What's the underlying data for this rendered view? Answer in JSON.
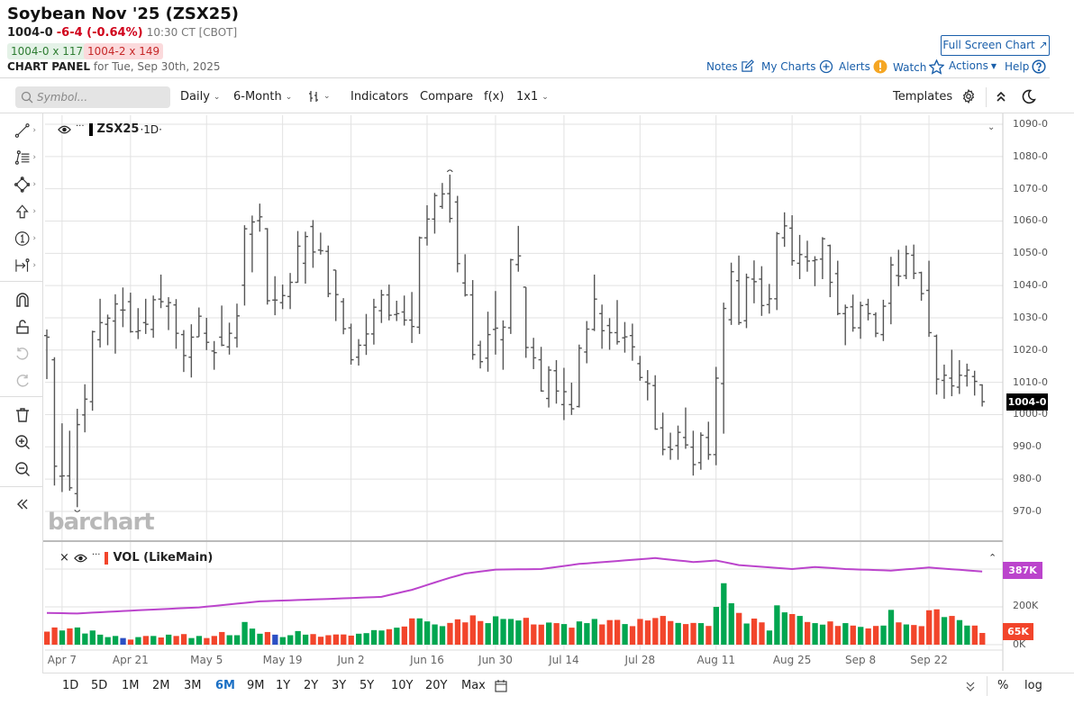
{
  "header": {
    "title": "Soybean Nov '25 (ZSX25)",
    "last": "1004-0",
    "change": "-6-4 (-0.64%)",
    "time": "10:30 CT [CBOT]",
    "bid": "1004-0 x 117",
    "ask": "1004-2 x 149",
    "panel_label": "CHART PANEL",
    "panel_date": "for Tue, Sep 30th, 2025",
    "full_screen": "Full Screen Chart",
    "links": {
      "notes": "Notes",
      "my_charts": "My Charts",
      "alerts": "Alerts",
      "watch": "Watch",
      "actions": "Actions",
      "help": "Help"
    }
  },
  "toolbar": {
    "symbol_placeholder": "Symbol...",
    "interval": "Daily",
    "range": "6-Month",
    "indicators": "Indicators",
    "compare": "Compare",
    "fx": "f(x)",
    "layout": "1x1",
    "templates": "Templates"
  },
  "left_tools": [
    "trend-line",
    "fibonacci",
    "shapes",
    "arrow",
    "annotation-number",
    "measure",
    "magnet",
    "lock",
    "undo",
    "redo",
    "delete",
    "zoom-in",
    "zoom-out",
    "collapse"
  ],
  "legend": {
    "symbol": "ZSX25",
    "interval": "·1D·",
    "volume": "VOL (LikeMain)"
  },
  "watermark": "barchart",
  "colors": {
    "up": "#00a650",
    "down": "#f2452b",
    "unch": "#2b4fc4",
    "ma": "#bb44cc",
    "bar": "#555555",
    "accent": "#1a5faa"
  },
  "chart_data": {
    "type": "ohlc",
    "title": "ZSX25 ·1D·",
    "ylim": [
      965,
      1093
    ],
    "yticks": [
      "1090-0",
      "1080-0",
      "1070-0",
      "1060-0",
      "1050-0",
      "1040-0",
      "1030-0",
      "1020-0",
      "1010-0",
      "1000-0",
      "990-0",
      "980-0",
      "970-0"
    ],
    "ytick_values": [
      1090,
      1080,
      1070,
      1060,
      1050,
      1040,
      1030,
      1020,
      1010,
      1000,
      990,
      980,
      970
    ],
    "last_price_label": "1004-0",
    "last_price": 1004,
    "x_labels": [
      {
        "label": "Apr 7",
        "bar": 2
      },
      {
        "label": "Apr 21",
        "bar": 11
      },
      {
        "label": "May 5",
        "bar": 21
      },
      {
        "label": "May 19",
        "bar": 31
      },
      {
        "label": "Jun 2",
        "bar": 40
      },
      {
        "label": "Jun 16",
        "bar": 50
      },
      {
        "label": "Jun 30",
        "bar": 59
      },
      {
        "label": "Jul 14",
        "bar": 68
      },
      {
        "label": "Jul 28",
        "bar": 78
      },
      {
        "label": "Aug 11",
        "bar": 88
      },
      {
        "label": "Aug 25",
        "bar": 98
      },
      {
        "label": "Sep 8",
        "bar": 107
      },
      {
        "label": "Sep 22",
        "bar": 116
      }
    ],
    "open": [
      1024.5,
      1017,
      980.9,
      981,
      975.5,
      999.9,
      1004,
      1023.2,
      1028,
      1029,
      1032.4,
      1035,
      1025.7,
      1028.5,
      1026.4,
      1035.8,
      1033.6,
      1034,
      1024.8,
      1017.8,
      1024.1,
      1025.2,
      1019.7,
      1024,
      1021,
      1023.8,
      1040.1,
      1055.9,
      1060.1,
      1057.6,
      1035.5,
      1034.7,
      1036.6,
      1041,
      1046.9,
      1058.3,
      1051,
      1050.6,
      1044.8,
      1035,
      1026.9,
      1017.8,
      1021.5,
      1025,
      1032.2,
      1037.1,
      1031,
      1031.8,
      1029.3,
      1027.1,
      1054.8,
      1060.6,
      1064.5,
      1068.5,
      1065.9,
      1040.8,
      1037.1,
      1021.5,
      1017.5,
      1026.4,
      1023.2,
      1026.9,
      1046.5,
      1039.5,
      1020.8,
      1017,
      1005,
      1013.6,
      1003.1,
      1003.1,
      1002.5,
      1019.4,
      1026.4,
      1031.3,
      1027.6,
      1025.4,
      1023.8,
      1024.5,
      1015.8,
      1010.1,
      1009,
      995.9,
      989.9,
      990.4,
      992.9,
      989.9,
      985.1,
      992.9,
      987.6,
      1009.6,
      1029.4,
      1041.5,
      1029.1,
      1042,
      1042,
      1034.1,
      1035.9,
      1054.8,
      1057.8,
      1046.9,
      1048.9,
      1047.7,
      1048.2,
      1052.4,
      1043.7,
      1031.3,
      1033.4,
      1026.9,
      1034.1,
      1031,
      1024.8,
      1034.5,
      1043.1,
      1043.1,
      1049.4,
      1044,
      1038.5,
      1024.3,
      1010.6,
      1011.3,
      1008.5,
      1012,
      1011.8,
      1009.2
    ],
    "high": [
      1026.4,
      1017.8,
      997.3,
      995,
      1001.8,
      1009.4,
      1026,
      1035.9,
      1031,
      1037.3,
      1039.4,
      1037.8,
      1033,
      1035.9,
      1036.9,
      1043.4,
      1036.4,
      1035.8,
      1026.2,
      1028,
      1033.2,
      1030,
      1022.8,
      1033.8,
      1028.5,
      1034.4,
      1058.7,
      1061.7,
      1065.4,
      1057.8,
      1042.9,
      1040.3,
      1043.9,
      1056.9,
      1056.7,
      1060.3,
      1056.4,
      1052.4,
      1044.8,
      1036.1,
      1028.2,
      1023.4,
      1031.2,
      1035.9,
      1038.7,
      1040.3,
      1035.3,
      1036.9,
      1038,
      1055.2,
      1064.9,
      1068.7,
      1071.8,
      1074.4,
      1067.8,
      1049.7,
      1041.7,
      1022.9,
      1031.9,
      1038.3,
      1029.2,
      1048.3,
      1058.5,
      1039.5,
      1023.8,
      1021,
      1015,
      1016.9,
      1014.5,
      1009.9,
      1021.7,
      1029,
      1043.4,
      1034.1,
      1029.9,
      1035.5,
      1028.7,
      1028.2,
      1018.2,
      1013.8,
      1012.2,
      1000.6,
      994.4,
      996.6,
      1002.2,
      995,
      994.5,
      997.8,
      1014.8,
      1034.7,
      1047.1,
      1049.3,
      1043.7,
      1047.8,
      1046,
      1040.5,
      1056.6,
      1062.7,
      1061.8,
      1055.7,
      1053.9,
      1049.1,
      1055,
      1052.7,
      1047.7,
      1034.1,
      1037.2,
      1035,
      1035.9,
      1031.7,
      1035.6,
      1048.9,
      1051.1,
      1052.4,
      1052.7,
      1044.3,
      1047.7,
      1024.8,
      1015.5,
      1020.1,
      1016.9,
      1015.8,
      1013.6,
      1009.4
    ],
    "low": [
      1011,
      978,
      976,
      976.4,
      971.3,
      994.5,
      1001.2,
      1020.8,
      1021.5,
      1018.9,
      1027.1,
      1025.4,
      1023.4,
      1025,
      1023.8,
      1033,
      1026.2,
      1020.4,
      1013.2,
      1011.5,
      1024.1,
      1020,
      1013.9,
      1021.2,
      1018.6,
      1020.8,
      1033.8,
      1044.1,
      1056.7,
      1034.1,
      1030.8,
      1032.7,
      1032.7,
      1040.9,
      1040.6,
      1045.5,
      1049.6,
      1036.4,
      1029,
      1024.9,
      1015.5,
      1015.2,
      1018.5,
      1021.7,
      1028.4,
      1029.2,
      1029,
      1027.6,
      1022.2,
      1025,
      1052.4,
      1056.1,
      1063.8,
      1059.5,
      1044.1,
      1036.6,
      1017,
      1014.3,
      1013.3,
      1018.6,
      1013.9,
      1025,
      1044.3,
      1017.6,
      1014.1,
      1007.1,
      1002.2,
      1003.4,
      998.3,
      999.9,
      1002.2,
      1015.9,
      1025.9,
      1020.4,
      1020.1,
      1021.7,
      1019.2,
      1016.7,
      1010.5,
      1004.4,
      995.3,
      987.4,
      986,
      986,
      989.4,
      981.1,
      982.9,
      986,
      984.3,
      994.1,
      1027.8,
      1027.8,
      1026.8,
      1034.5,
      1030.6,
      1031.3,
      1032.4,
      1052,
      1046.2,
      1042,
      1044.3,
      1039.8,
      1042,
      1036.4,
      1030.8,
      1021.5,
      1025.7,
      1023.5,
      1029.2,
      1024,
      1022.8,
      1028,
      1039.8,
      1042,
      1042,
      1035.3,
      1024.1,
      1006.2,
      1004.9,
      1005.7,
      1006.4,
      1008.7,
      1005.9,
      1002.5
    ],
    "close": [
      1024,
      984,
      981,
      977.3,
      996.9,
      1004.8,
      1025.7,
      1028.5,
      1029.9,
      1034.3,
      1032.4,
      1025.7,
      1026,
      1028,
      1035.6,
      1035,
      1034.7,
      1025.2,
      1018.3,
      1024,
      1030.5,
      1022.4,
      1019.2,
      1021.5,
      1025.2,
      1030.6,
      1057.6,
      1059.7,
      1061.3,
      1035.3,
      1035.5,
      1036.9,
      1041,
      1052.2,
      1055.2,
      1050.4,
      1050.8,
      1037.5,
      1037.2,
      1026.6,
      1017,
      1021.5,
      1025,
      1033.3,
      1037.1,
      1030.8,
      1031.3,
      1029.3,
      1027.3,
      1054.8,
      1060.6,
      1067.9,
      1068.4,
      1060.8,
      1046.8,
      1037.1,
      1018.6,
      1016.4,
      1024.8,
      1026.8,
      1027.1,
      1048,
      1049.2,
      1020.8,
      1017.6,
      1007.3,
      1013.8,
      1007.3,
      1007.1,
      1001.8,
      1020.6,
      1026.5,
      1035.8,
      1026,
      1025.4,
      1022.6,
      1024.1,
      1021,
      1011.5,
      1009.6,
      995.5,
      989.2,
      989.2,
      994.5,
      990.6,
      984.5,
      993.6,
      987.6,
      1011.3,
      1032.9,
      1044.3,
      1028.5,
      1042.5,
      1041.2,
      1033.8,
      1035.9,
      1056.1,
      1058.5,
      1047.7,
      1049.6,
      1047.6,
      1048,
      1054.5,
      1041,
      1031.3,
      1033.2,
      1026.9,
      1033.8,
      1031.3,
      1025.2,
      1033.6,
      1046.4,
      1042.9,
      1049.9,
      1043.8,
      1037.5,
      1025.4,
      1011,
      1012.2,
      1008.9,
      1012.2,
      1013.8,
      1010.3,
      1004
    ],
    "high_marker_bar": 54,
    "low_marker_bar": 5,
    "volume": {
      "unit": "K",
      "ylim": [
        0,
        420
      ],
      "yticks": [
        {
          "label": "200K",
          "value": 200
        },
        {
          "label": "0K",
          "value": 0
        }
      ],
      "values": [
        69,
        91,
        75,
        86,
        91,
        59,
        75,
        53,
        40,
        46,
        35,
        27,
        40,
        46,
        46,
        38,
        53,
        46,
        56,
        35,
        46,
        35,
        46,
        67,
        50,
        50,
        120,
        85,
        58,
        67,
        53,
        40,
        50,
        72,
        53,
        56,
        42,
        50,
        54,
        54,
        48,
        58,
        61,
        77,
        75,
        82,
        90,
        96,
        139,
        139,
        123,
        107,
        98,
        115,
        134,
        118,
        155,
        125,
        114,
        150,
        136,
        136,
        128,
        142,
        107,
        106,
        117,
        114,
        109,
        90,
        123,
        114,
        136,
        107,
        130,
        131,
        109,
        98,
        136,
        128,
        141,
        152,
        125,
        115,
        109,
        115,
        114,
        99,
        200,
        325,
        219,
        168,
        112,
        138,
        118,
        75,
        208,
        171,
        162,
        152,
        120,
        114,
        106,
        123,
        99,
        114,
        101,
        94,
        86,
        99,
        101,
        184,
        118,
        107,
        104,
        98,
        182,
        187,
        146,
        152,
        130,
        101,
        101,
        62
      ],
      "dir": [
        "r",
        "r",
        "g",
        "r",
        "g",
        "g",
        "g",
        "g",
        "g",
        "g",
        "b",
        "r",
        "g",
        "r",
        "g",
        "r",
        "g",
        "r",
        "r",
        "g",
        "g",
        "r",
        "r",
        "r",
        "g",
        "g",
        "g",
        "g",
        "g",
        "r",
        "b",
        "g",
        "g",
        "g",
        "g",
        "r",
        "r",
        "r",
        "r",
        "r",
        "r",
        "g",
        "g",
        "g",
        "g",
        "r",
        "g",
        "r",
        "r",
        "g",
        "g",
        "g",
        "g",
        "r",
        "r",
        "r",
        "r",
        "r",
        "g",
        "g",
        "g",
        "g",
        "g",
        "r",
        "r",
        "r",
        "g",
        "r",
        "g",
        "r",
        "g",
        "g",
        "g",
        "r",
        "r",
        "r",
        "g",
        "r",
        "r",
        "r",
        "r",
        "r",
        "r",
        "g",
        "r",
        "r",
        "g",
        "r",
        "g",
        "g",
        "g",
        "r",
        "g",
        "r",
        "r",
        "g",
        "g",
        "g",
        "r",
        "g",
        "r",
        "g",
        "g",
        "r",
        "r",
        "g",
        "r",
        "g",
        "r",
        "r",
        "g",
        "g",
        "r",
        "g",
        "r",
        "r",
        "r",
        "r",
        "g",
        "r",
        "g",
        "g",
        "r",
        "r"
      ],
      "ma_points": [
        [
          1,
          168
        ],
        [
          5,
          165
        ],
        [
          11,
          178
        ],
        [
          21,
          197
        ],
        [
          29,
          229
        ],
        [
          40,
          245
        ],
        [
          45,
          253
        ],
        [
          49,
          290
        ],
        [
          54,
          354
        ],
        [
          56,
          376
        ],
        [
          60,
          397
        ],
        [
          66,
          400
        ],
        [
          71,
          427
        ],
        [
          81,
          458
        ],
        [
          86,
          437
        ],
        [
          89,
          445
        ],
        [
          92,
          421
        ],
        [
          99,
          400
        ],
        [
          102,
          411
        ],
        [
          106,
          400
        ],
        [
          112,
          392
        ],
        [
          117,
          408
        ],
        [
          124,
          387
        ]
      ],
      "ma_label": "387K",
      "last_label": "65K"
    }
  },
  "range_buttons": [
    "1D",
    "5D",
    "1M",
    "2M",
    "3M",
    "6M",
    "9M",
    "1Y",
    "2Y",
    "3Y",
    "5Y",
    "10Y",
    "20Y",
    "Max"
  ],
  "active_range": "6M",
  "bottom_right": {
    "percent": "%",
    "log": "log"
  }
}
